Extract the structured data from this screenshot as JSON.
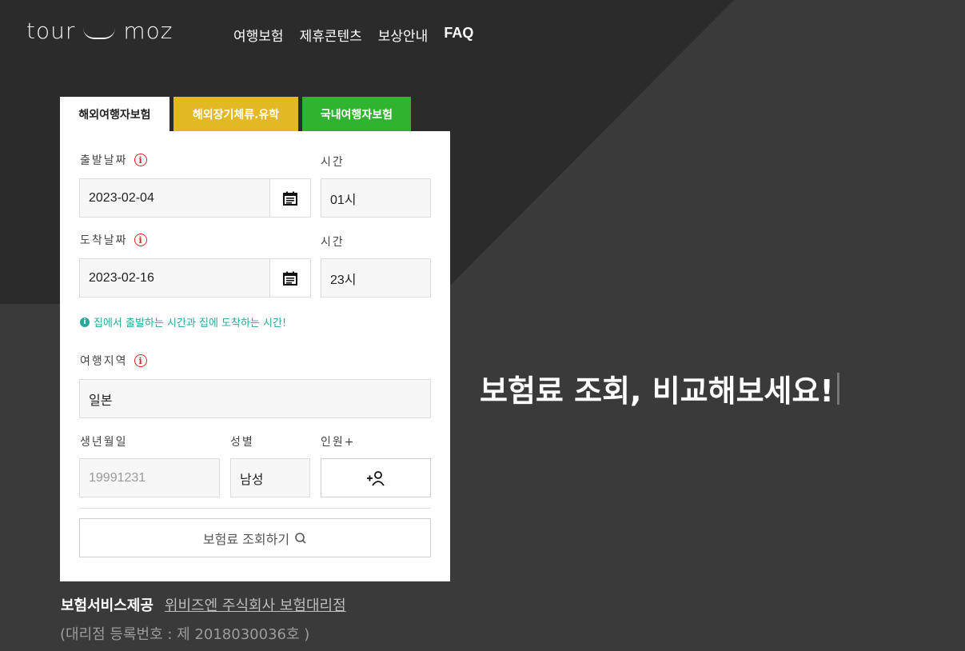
{
  "header": {
    "logo_left": "tour",
    "logo_right": "moz",
    "nav": [
      "여행보험",
      "제휴콘텐츠",
      "보상안내",
      "FAQ"
    ]
  },
  "tabs": [
    "해외여행자보험",
    "해외장기체류.유학",
    "국내여행자보험"
  ],
  "form": {
    "depart_label": "출발날짜",
    "depart_date": "2023-02-04",
    "depart_time_label": "시간",
    "depart_time": "01시",
    "arrive_label": "도착날짜",
    "arrive_date": "2023-02-16",
    "arrive_time_label": "시간",
    "arrive_time": "23시",
    "notice": "집에서 출발하는 시간과 집에 도착하는 시간!",
    "region_label": "여행지역",
    "region_value": "일본",
    "birth_label": "생년월일",
    "birth_placeholder": "19991231",
    "gender_label": "성별",
    "gender_value": "남성",
    "people_label": "인원+",
    "search_button": "보험료 조회하기"
  },
  "hero_text": "보험료 조회, 비교해보세요!",
  "footer": {
    "provider_label": "보험서비스제공",
    "provider_link": "위비즈엔 주식회사 보험대리점",
    "registration": "(대리점 등록번호 : 제 2018030036호 )"
  },
  "colors": {
    "tab_yellow": "#e2b824",
    "tab_green": "#30b430",
    "notice_teal": "#2aa89a",
    "info_red": "#e0241f"
  }
}
